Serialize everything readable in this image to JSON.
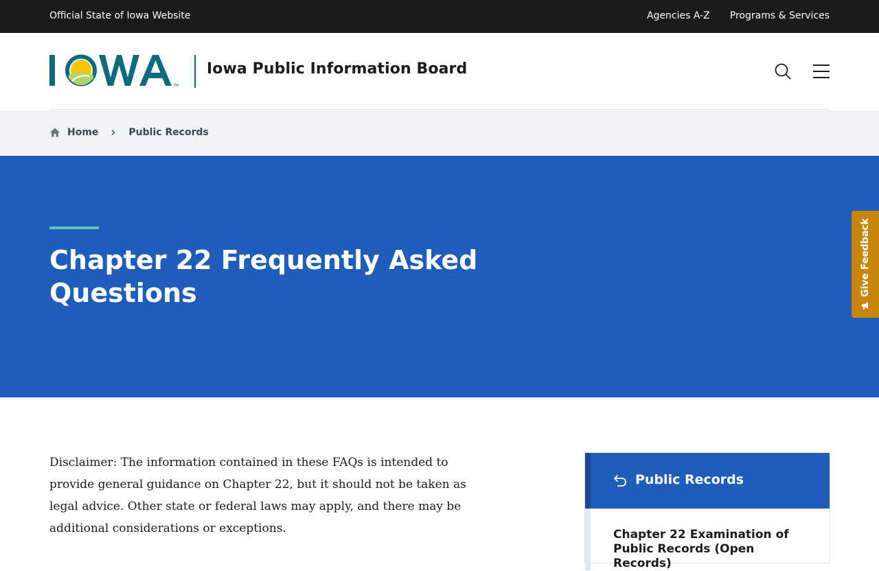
{
  "topbar": {
    "official": "Official State of Iowa Website",
    "links": [
      "Agencies A-Z",
      "Programs & Services"
    ]
  },
  "header": {
    "logo_text": "IOWA",
    "site_name": "Iowa Public Information Board",
    "icons": {
      "search": "search-icon",
      "menu": "hamburger-menu-icon"
    }
  },
  "breadcrumb": {
    "home": "Home",
    "current": "Public Records"
  },
  "hero": {
    "title": "Chapter 22 Frequently Asked Questions"
  },
  "feedback": {
    "label": "Give Feedback"
  },
  "content": {
    "disclaimer": "Disclaimer: The information contained in these FAQs is intended to provide general guidance on Chapter 22, but it should not be taken as legal advice. Other state or federal laws may apply, and there may be additional considerations or exceptions."
  },
  "sidenav": {
    "heading": "Public Records",
    "items": [
      "Chapter 22 Examination of Public Records (Open Records)"
    ]
  },
  "colors": {
    "topbar": "#1b1b1b",
    "hero": "#1e5dba",
    "accent": "#5fc0b4",
    "logo_teal": "#0c6c7e",
    "feedback": "#c5860b",
    "breadcrumb_bg": "#f0f2f6"
  }
}
